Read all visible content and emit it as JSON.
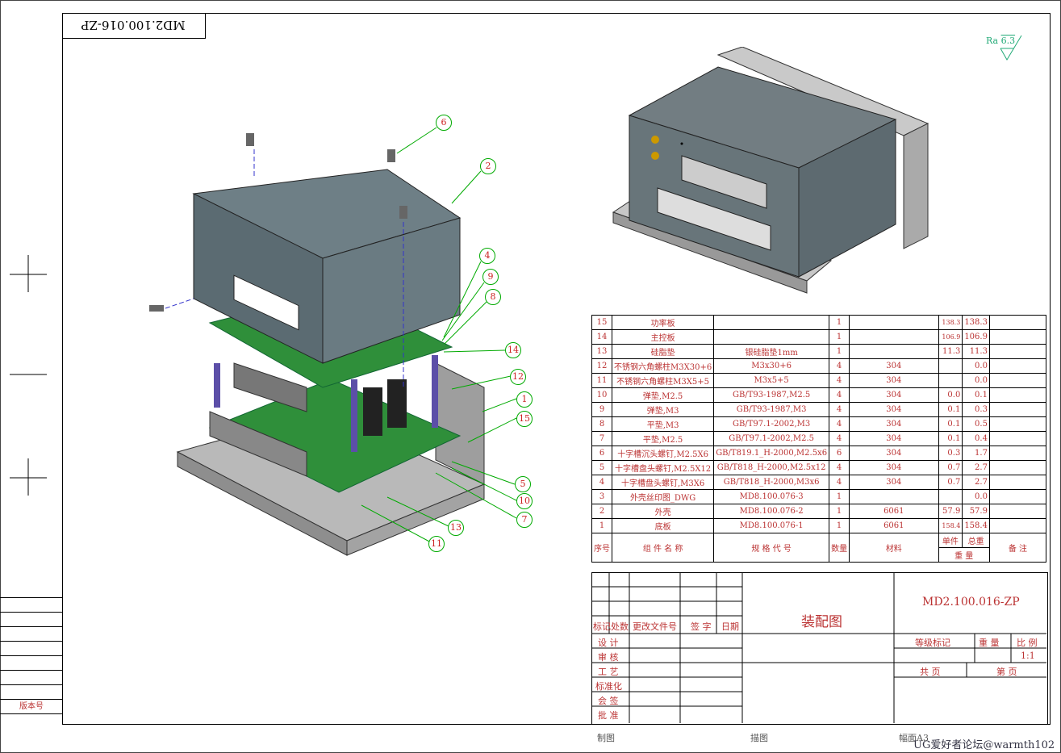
{
  "drawing_number_top": "MD2.100.016-ZP",
  "roughness": {
    "label": "Ra",
    "value": "6.3"
  },
  "balloons": [
    "6",
    "2",
    "4",
    "9",
    "8",
    "14",
    "12",
    "1",
    "15",
    "5",
    "10",
    "7",
    "13",
    "11"
  ],
  "bom": {
    "rows": [
      [
        "15",
        "功率板",
        "",
        "1",
        "",
        "138.3",
        "138.3",
        ""
      ],
      [
        "14",
        "主控板",
        "",
        "1",
        "",
        "106.9",
        "106.9",
        ""
      ],
      [
        "13",
        "硅脂垫",
        "银硅脂垫1mm",
        "1",
        "",
        "11.3",
        "11.3",
        ""
      ],
      [
        "12",
        "不锈钢六角螺柱M3X30+6",
        "M3x30+6",
        "4",
        "304",
        "",
        "0.0",
        ""
      ],
      [
        "11",
        "不锈钢六角螺柱M3X5+5",
        "M3x5+5",
        "4",
        "304",
        "",
        "0.0",
        ""
      ],
      [
        "10",
        "弹垫,M2.5",
        "GB/T93-1987,M2.5",
        "4",
        "304",
        "0.0",
        "0.1",
        ""
      ],
      [
        "9",
        "弹垫,M3",
        "GB/T93-1987,M3",
        "4",
        "304",
        "0.1",
        "0.3",
        ""
      ],
      [
        "8",
        "平垫,M3",
        "GB/T97.1-2002,M3",
        "4",
        "304",
        "0.1",
        "0.5",
        ""
      ],
      [
        "7",
        "平垫,M2.5",
        "GB/T97.1-2002,M2.5",
        "4",
        "304",
        "0.1",
        "0.4",
        ""
      ],
      [
        "6",
        "十字槽沉头螺钉,M2.5X6",
        "GB/T819.1_H-2000,M2.5x6",
        "6",
        "304",
        "0.3",
        "1.7",
        ""
      ],
      [
        "5",
        "十字槽盘头螺钉,M2.5X12",
        "GB/T818_H-2000,M2.5x12",
        "4",
        "304",
        "0.7",
        "2.7",
        ""
      ],
      [
        "4",
        "十字槽盘头螺钉,M3X6",
        "GB/T818_H-2000,M3x6",
        "4",
        "304",
        "0.7",
        "2.7",
        ""
      ],
      [
        "3",
        "外壳丝印图_DWG",
        "MD8.100.076-3",
        "1",
        "",
        "",
        "0.0",
        ""
      ],
      [
        "2",
        "外壳",
        "MD8.100.076-2",
        "1",
        "6061",
        "57.9",
        "57.9",
        ""
      ],
      [
        "1",
        "底板",
        "MD8.100.076-1",
        "1",
        "6061",
        "158.4",
        "158.4",
        ""
      ]
    ],
    "header": {
      "seq": "序号",
      "name": "组 件 名 称",
      "code": "规 格 代 号",
      "qty": "数量",
      "material": "材料",
      "unit": "单件",
      "total": "总重",
      "weight": "重 量",
      "remark": "备 注"
    }
  },
  "title_block": {
    "title": "装配图",
    "drawing_number": "MD2.100.016-ZP",
    "rev_labels": [
      "标记",
      "处数",
      "更改文件号",
      "签 字",
      "日期"
    ],
    "roles": [
      "设 计",
      "审 核",
      "工 艺",
      "标准化",
      "会 签",
      "批 准"
    ],
    "grade_label": "等级标记",
    "weight_label": "重 量",
    "scale_label": "比 例",
    "scale_value": "1:1",
    "total_pages": "共 页",
    "page_no": "第 页"
  },
  "side_label": "版本号",
  "bottom": {
    "drawn": "制图",
    "traced": "描图",
    "format": "幅面A3"
  },
  "watermark": "UG爱好者论坛@warmth102"
}
